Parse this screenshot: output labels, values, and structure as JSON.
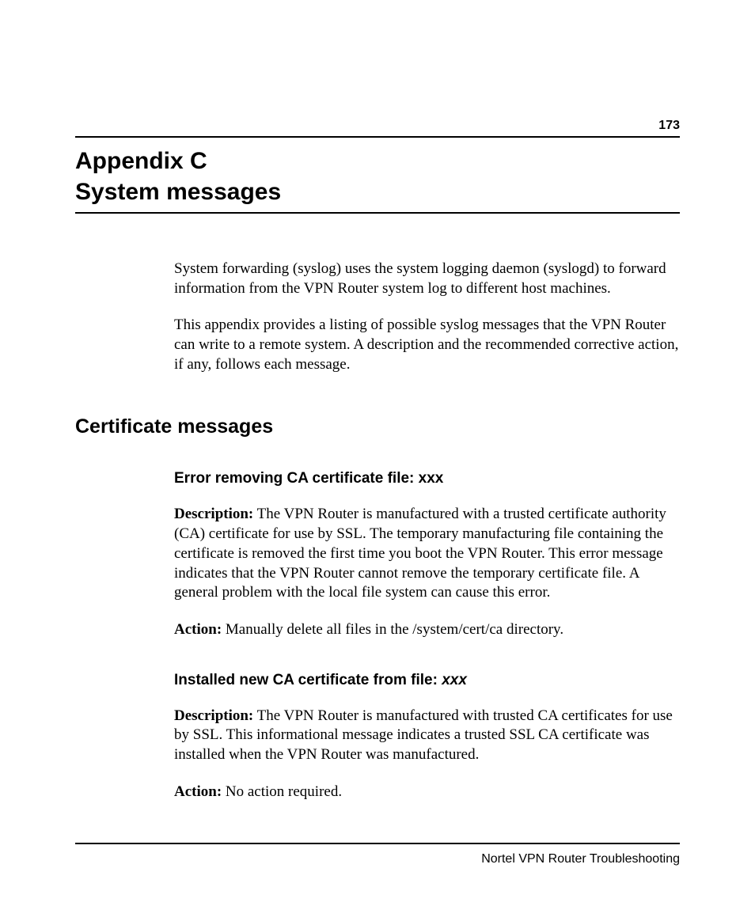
{
  "pageNumber": "173",
  "title": {
    "line1": "Appendix C",
    "line2": "System messages"
  },
  "intro": {
    "p1": "System forwarding (syslog) uses the system logging daemon (syslogd) to forward information from the VPN Router system log to different host machines.",
    "p2": "This appendix provides a listing of possible syslog messages that the VPN Router can write to a remote system. A description and the recommended corrective action, if any, follows each message."
  },
  "sectionTitle": "Certificate messages",
  "labels": {
    "description": "Description:",
    "action": "Action:"
  },
  "messages": [
    {
      "title": "Error removing CA certificate file: xxx",
      "titleItalic": "",
      "description": " The VPN Router is manufactured with a trusted certificate authority (CA) certificate for use by SSL. The temporary manufacturing file containing the certificate is removed the first time you boot the VPN Router. This error message indicates that the VPN Router cannot remove the temporary certificate file. A general problem with the local file system can cause this error.",
      "action": " Manually delete all files in the  /system/cert/ca directory."
    },
    {
      "title": "Installed new CA certificate from file: ",
      "titleItalic": "xxx",
      "description": " The VPN Router is manufactured with trusted CA certificates for use by SSL. This informational message indicates a trusted SSL CA certificate was installed when the VPN Router was manufactured.",
      "action": " No action required."
    }
  ],
  "footer": "Nortel VPN Router Troubleshooting"
}
